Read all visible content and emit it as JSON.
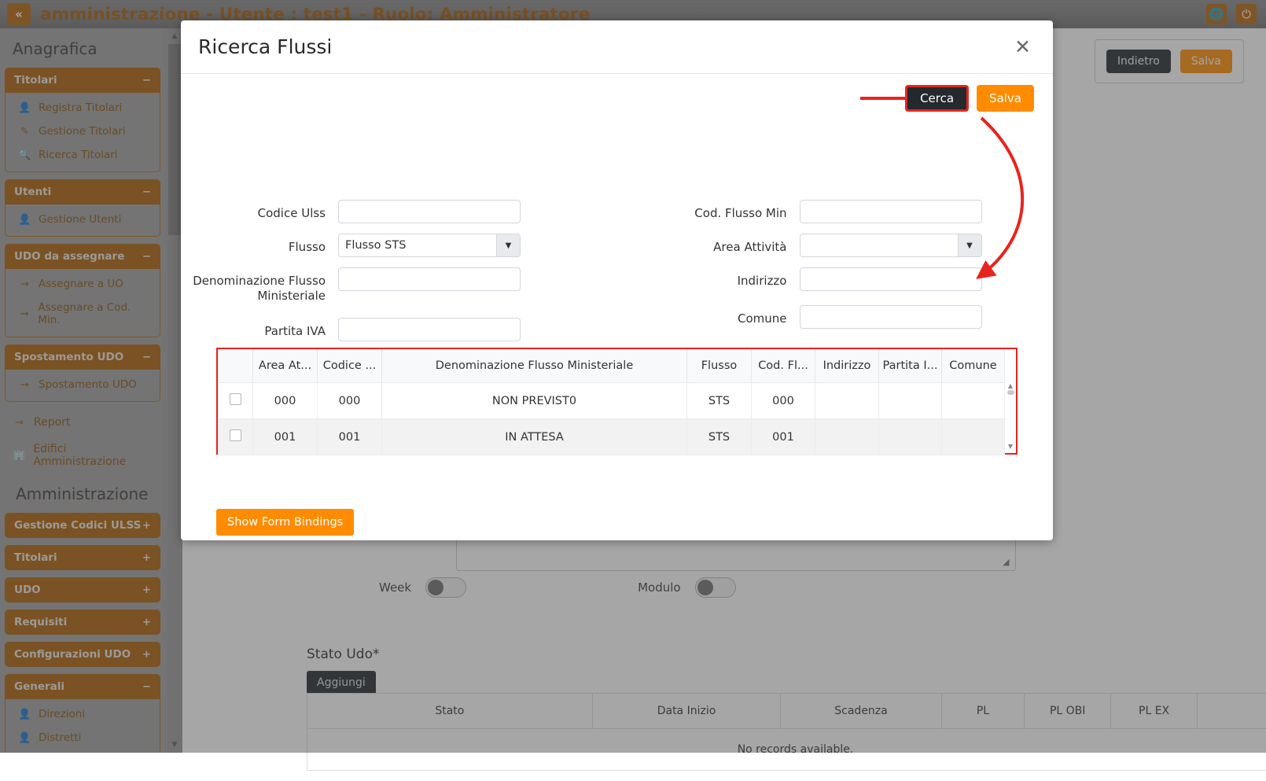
{
  "header": {
    "collapse_icon": "chevrons-left-icon",
    "title": "amministrazione - Utente : test1 - Ruolo: Amministratore",
    "globe_icon": "globe-icon",
    "power_icon": "power-icon"
  },
  "sidebar": {
    "section_title": "Anagrafica",
    "section_title2": "Amministrazione",
    "groups": [
      {
        "label": "Titolari",
        "toggle": "−",
        "items": [
          {
            "label": "Registra Titolari",
            "icon": "user-edit-icon"
          },
          {
            "label": "Gestione Titolari",
            "icon": "edit-square-icon"
          },
          {
            "label": "Ricerca Titolari",
            "icon": "search-icon"
          }
        ]
      },
      {
        "label": "Utenti",
        "toggle": "−",
        "items": [
          {
            "label": "Gestione Utenti",
            "icon": "user-edit-icon"
          }
        ]
      },
      {
        "label": "UDO da assegnare",
        "toggle": "−",
        "items": [
          {
            "label": "Assegnare a UO",
            "icon": "arrow-right-icon"
          },
          {
            "label": "Assegnare a Cod. Min.",
            "icon": "arrow-right-icon"
          }
        ]
      },
      {
        "label": "Spostamento UDO",
        "toggle": "−",
        "items": [
          {
            "label": "Spostamento UDO",
            "icon": "arrow-right-icon"
          }
        ]
      }
    ],
    "plain_items": [
      {
        "label": "Report",
        "icon": "arrow-right-icon"
      },
      {
        "label": "Edifici Amministrazione",
        "icon": "building-icon"
      }
    ],
    "admin_groups": [
      {
        "label": "Gestione Codici ULSS",
        "toggle": "+"
      },
      {
        "label": "Titolari",
        "toggle": "+"
      },
      {
        "label": "UDO",
        "toggle": "+"
      },
      {
        "label": "Requisiti",
        "toggle": "+"
      },
      {
        "label": "Configurazioni UDO",
        "toggle": "+"
      }
    ],
    "generali": {
      "label": "Generali",
      "toggle": "−",
      "items": [
        {
          "label": "Direzioni",
          "icon": "user-edit-icon"
        },
        {
          "label": "Distretti",
          "icon": "user-edit-icon"
        }
      ]
    }
  },
  "background": {
    "indietro_label": "Indietro",
    "salva_label": "Salva",
    "week_label": "Week",
    "modulo_label": "Modulo",
    "stato_udo_label": "Stato Udo*",
    "aggiungi_label": "Aggiungi",
    "table_headers": [
      "Stato",
      "Data Inizio",
      "Scadenza",
      "PL",
      "PL OBI",
      "PL EX",
      ""
    ],
    "empty_message": "No records available."
  },
  "modal": {
    "title": "Ricerca Flussi",
    "close_icon": "close-icon",
    "cerca_label": "Cerca",
    "salva_label": "Salva",
    "bindings_label": "Show Form Bindings",
    "form_left": [
      {
        "label": "Codice Ulss",
        "type": "text",
        "value": ""
      },
      {
        "label": "Flusso",
        "type": "select",
        "value": "Flusso STS"
      },
      {
        "label": "Denominazione Flusso Ministeriale",
        "type": "text",
        "value": ""
      },
      {
        "label": "Partita IVA",
        "type": "text",
        "value": ""
      }
    ],
    "form_right": [
      {
        "label": "Cod. Flusso Min",
        "type": "text",
        "value": ""
      },
      {
        "label": "Area Attività",
        "type": "select",
        "value": ""
      },
      {
        "label": "Indirizzo",
        "type": "text",
        "value": ""
      },
      {
        "label": "Comune",
        "type": "text",
        "value": ""
      }
    ],
    "results": {
      "headers": [
        "",
        "Area At...",
        "Codice ...",
        "Denominazione Flusso Ministeriale",
        "Flusso",
        "Cod. Fl...",
        "Indirizzo",
        "Partita I...",
        "Comune"
      ],
      "rows": [
        {
          "checked": false,
          "area_attivita": "000",
          "codice": "000",
          "denominazione": "NON PREVIST0",
          "flusso": "STS",
          "cod_flusso": "000",
          "indirizzo": "",
          "partita_iva": "",
          "comune": ""
        },
        {
          "checked": false,
          "area_attivita": "001",
          "codice": "001",
          "denominazione": "IN ATTESA",
          "flusso": "STS",
          "cod_flusso": "001",
          "indirizzo": "",
          "partita_iva": "",
          "comune": ""
        }
      ]
    }
  },
  "colors": {
    "accent_orange": "#b4650a",
    "brand_text": "#a65a06",
    "annotation_red": "#e8241f",
    "button_orange": "#ff8c00",
    "dark_button": "#24292e"
  }
}
